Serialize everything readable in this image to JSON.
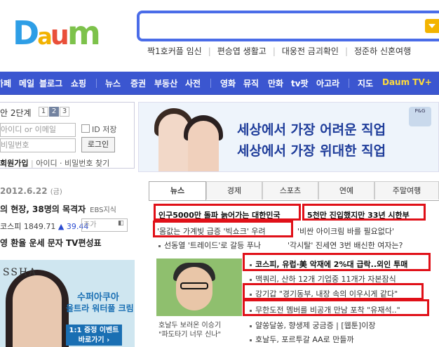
{
  "logo": {
    "text": "Daum",
    "colors": [
      "#2e9ee6",
      "#f2b200",
      "#e94f3a",
      "#7dc24b"
    ]
  },
  "search": {
    "placeholder": "",
    "button_icon": "chevron-down-icon"
  },
  "keywords": [
    "짝1호커플 임신",
    "편승엽 생활고",
    "대웅전 금괴확인",
    "정준하 신혼여행"
  ],
  "nav": {
    "group1": [
      "카페",
      "메일",
      "블로그",
      "쇼핑"
    ],
    "group2": [
      "뉴스",
      "증권",
      "부동산",
      "사전"
    ],
    "group3": [
      "영화",
      "뮤직",
      "만화",
      "tv팟",
      "아고라"
    ],
    "group4": [
      "지도"
    ],
    "tv": "Daum TV+",
    "bg_color": "#3b56d0"
  },
  "login": {
    "step": "안 2단계",
    "pages": [
      "1",
      "2",
      "3"
    ],
    "active_page": 2,
    "id_placeholder": "아이디 or 이메일",
    "pw_placeholder": "비밀번호",
    "save_id": "ID 저장",
    "login_button": "로그인",
    "join": "회원가입",
    "find": "아이디 · 비밀번호 찾기"
  },
  "date": {
    "text": "2012.6.22",
    "day": "(금)"
  },
  "left_headline": {
    "text": "의 현장, 38명의 목격자",
    "source": "EBS지식"
  },
  "kospi": {
    "label": "코스피",
    "value": "1849.71",
    "change": "▲ 39.44",
    "input_placeholder": "주가"
  },
  "quick_links": "영  환율  운세  문자  TV편성표",
  "ad": {
    "brand": "SSHA",
    "line1": "수퍼아쿠아",
    "line2": "울트라 워터풀 크림",
    "event1": "1:1 증정 이벤트",
    "event2": "바로가기 ›"
  },
  "banner": {
    "line1": "세상에서 가장 어려운 직업",
    "line2": "세상에서 가장 위대한 직업",
    "badge": "P&G"
  },
  "tabs": [
    "뉴스",
    "경제",
    "스포츠",
    "연예",
    "주말여행"
  ],
  "news_top": [
    {
      "text": "인구5000만 돌파 늙어가는 대한민국",
      "bold": true
    },
    {
      "text": "5천만 진입했지만 33년 시한부",
      "bold": true
    },
    {
      "text": "'몸값는 가계빚 급증 '빅쇼크' 우려",
      "bold": false
    },
    {
      "text": "'비싼 아이크림 바를 필요없다'",
      "bold": false
    },
    {
      "text": "선동열 '트레이드'로 갈등 푸나",
      "bold": false
    },
    {
      "text": "'각시탈' 진세연 3번 배신한 여자는?",
      "bold": false
    }
  ],
  "news_side": [
    {
      "text": "코스피, 유럽·美 악재에 2%대 급락..외인 투매",
      "bold": true
    },
    {
      "text": "맥쿼리, 산하 12개 기업중 11개가 자본잠식",
      "bold": false
    },
    {
      "text": "강기갑 \"경기동부, 내장 속의 이우시게 같다\"",
      "bold": false
    },
    {
      "text": "무한도전 멤버를 비공개 만남 포착 \"유재석..\"",
      "bold": false
    },
    {
      "text": "얄쏭달쏭, 향생제 궁금증  |  [웹툰]이장",
      "bold": false
    },
    {
      "text": "호날두, 포르투갈 AA로 만들까",
      "bold": false
    }
  ],
  "caption": {
    "line1": "호날두 보러온 이승기",
    "line2": "\"파도타기 너무 신나\""
  }
}
